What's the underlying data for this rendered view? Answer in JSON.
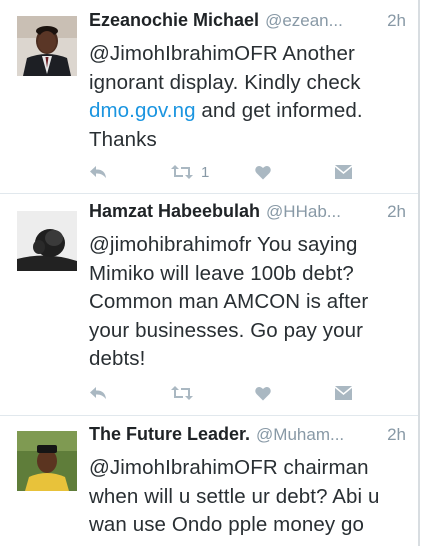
{
  "tweets": [
    {
      "name": "Ezeanochie Michael",
      "handle": "@ezean...",
      "time": "2h",
      "text_before": "@JimohIbrahimOFR Another ignorant display. Kindly check ",
      "link": "dmo.gov.ng",
      "text_after": " and get informed. Thanks",
      "retweet_count": "1"
    },
    {
      "name": "Hamzat Habeebulah",
      "handle": "@HHab...",
      "time": "2h",
      "text_before": "@jimohibrahimofr You saying Mimiko will leave 100b debt? Common man AMCON is after your businesses. Go pay your debts!",
      "retweet_count": ""
    },
    {
      "name": "The Future Leader.",
      "handle": "@Muham...",
      "time": "2h",
      "text_before": "@JimohIbrahimOFR chairman when will u settle ur debt? Abi u wan use Ondo pple money go"
    }
  ],
  "icons": {
    "reply": "reply-icon",
    "retweet": "retweet-icon",
    "like": "heart-icon",
    "message": "direct-message-icon"
  },
  "colors": {
    "link": "#1b95e0",
    "secondary_text": "#8899a6",
    "action_icon": "#aab8c2"
  }
}
